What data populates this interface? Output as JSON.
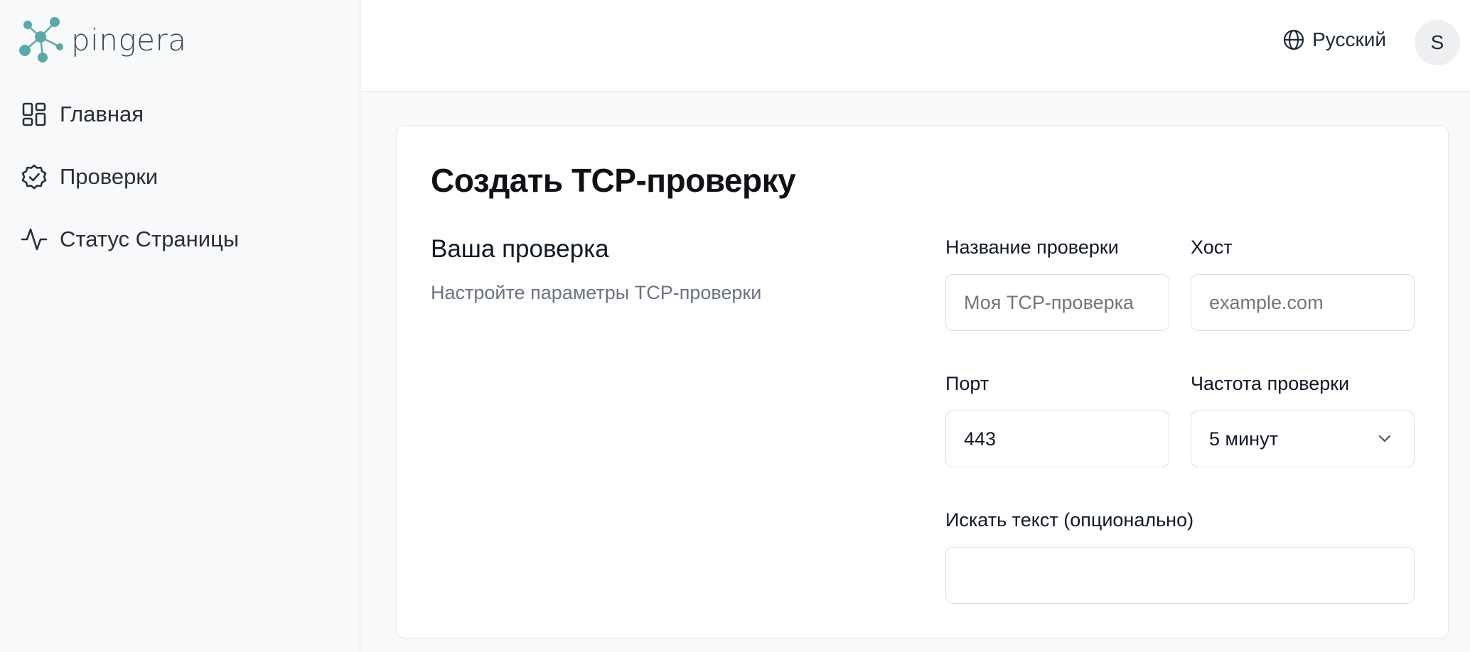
{
  "app": {
    "logo_text": "pingera"
  },
  "sidebar": {
    "items": [
      {
        "label": "Главная",
        "icon": "dashboard-icon"
      },
      {
        "label": "Проверки",
        "icon": "badge-check-icon"
      },
      {
        "label": "Статус Страницы",
        "icon": "activity-icon"
      }
    ]
  },
  "header": {
    "language": "Русский",
    "avatar_initial": "S"
  },
  "form": {
    "title": "Создать TCP-проверку",
    "section_title": "Ваша проверка",
    "section_desc": "Настройте параметры TCP-проверки",
    "name": {
      "label": "Название проверки",
      "placeholder": "Моя TCP-проверка"
    },
    "host": {
      "label": "Хост",
      "placeholder": "example.com"
    },
    "port": {
      "label": "Порт",
      "value": "443"
    },
    "frequency": {
      "label": "Частота проверки",
      "value": "5 минут"
    },
    "search_text": {
      "label": "Искать текст (опционально)",
      "value": ""
    }
  },
  "colors": {
    "brand": "#5aa9a9",
    "text": "#111827",
    "muted": "#6b7280",
    "border": "#e5e7eb"
  }
}
